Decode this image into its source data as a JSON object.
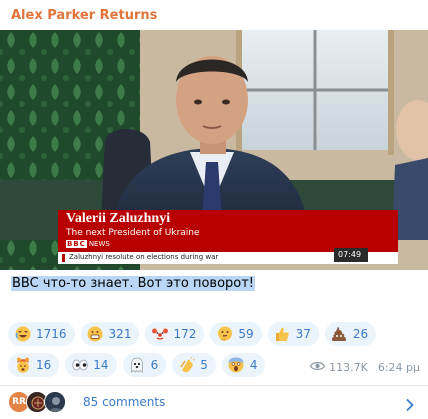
{
  "channel": {
    "title": "Alex Parker Returns"
  },
  "media": {
    "lower_third": {
      "name": "Valerii Zaluzhnyi",
      "subtitle": "The next President of Ukraine",
      "network": "BBC",
      "network_suffix": "NEWS",
      "ticker": "Zaluzhnyi resolute on elections during war",
      "clock": "07:49"
    }
  },
  "caption": "BBC что-то знает. Вот это поворот!",
  "reactions": [
    {
      "icon": "rofl-emoji-icon",
      "count": "1716"
    },
    {
      "icon": "grin-emoji-icon",
      "count": "321"
    },
    {
      "icon": "clown-emoji-icon",
      "count": "172"
    },
    {
      "icon": "thinking-emoji-icon",
      "count": "59"
    },
    {
      "icon": "thumbs-up-emoji-icon",
      "count": "37"
    },
    {
      "icon": "poop-emoji-icon",
      "count": "26"
    },
    {
      "icon": "exploding-head-emoji-icon",
      "count": "16"
    },
    {
      "icon": "eyes-emoji-icon",
      "count": "14"
    },
    {
      "icon": "ghost-emoji-icon",
      "count": "6"
    },
    {
      "icon": "clapping-emoji-icon",
      "count": "5"
    },
    {
      "icon": "screaming-emoji-icon",
      "count": "4"
    }
  ],
  "meta": {
    "views": "113.7K",
    "time": "6:24 pμ"
  },
  "comments": {
    "label": "85 comments",
    "first_avatar_initials": "RR"
  },
  "colors": {
    "accent": "#3a7bc8",
    "channel_title": "#e0743a",
    "bbc_red": "#b80000",
    "pill_bg": "#ebf3fb"
  }
}
